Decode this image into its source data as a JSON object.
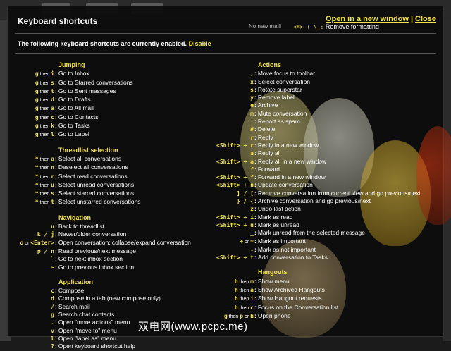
{
  "dialog": {
    "title": "Keyboard shortcuts",
    "open_new_window": "Open in a new window",
    "separator": "|",
    "close": "Close",
    "enabled_text": "The following keyboard shortcuts are currently enabled.",
    "disable": "Disable",
    "no_new_mail": "No new mail!",
    "remove_formatting_keys": "<⌘> + \\ :",
    "remove_formatting": "Remove formatting"
  },
  "jumping": {
    "title": "Jumping",
    "rows": [
      {
        "k": "g",
        "t": "i",
        "d": "Go to Inbox"
      },
      {
        "k": "g",
        "t": "s",
        "d": "Go to Starred conversations"
      },
      {
        "k": "g",
        "t": "t",
        "d": "Go to Sent messages"
      },
      {
        "k": "g",
        "t": "d",
        "d": "Go to Drafts"
      },
      {
        "k": "g",
        "t": "a",
        "d": "Go to All mail"
      },
      {
        "k": "g",
        "t": "c",
        "d": "Go to Contacts"
      },
      {
        "k": "g",
        "t": "k",
        "d": "Go to Tasks"
      },
      {
        "k": "g",
        "t": "l",
        "d": "Go to Label"
      }
    ]
  },
  "threadlist": {
    "title": "Threadlist selection",
    "rows": [
      {
        "k": "*",
        "t": "a",
        "d": "Select all conversations"
      },
      {
        "k": "*",
        "t": "n",
        "d": "Deselect all conversations"
      },
      {
        "k": "*",
        "t": "r",
        "d": "Select read conversations"
      },
      {
        "k": "*",
        "t": "u",
        "d": "Select unread conversations"
      },
      {
        "k": "*",
        "t": "s",
        "d": "Select starred conversations"
      },
      {
        "k": "*",
        "t": "t",
        "d": "Select unstarred conversations"
      }
    ]
  },
  "navigation": {
    "title": "Navigation",
    "rows": [
      {
        "keys": "u",
        "d": "Back to threadlist"
      },
      {
        "keys": "k / j",
        "d": "Newer/older conversation"
      },
      {
        "keys": "o or <Enter>",
        "d": "Open conversation; collapse/expand conversation"
      },
      {
        "keys": "p / n",
        "d": "Read previous/next message"
      },
      {
        "keys": "`",
        "d": "Go to next inbox section"
      },
      {
        "keys": "~",
        "d": "Go to previous inbox section"
      }
    ]
  },
  "application": {
    "title": "Application",
    "rows": [
      {
        "keys": "c",
        "d": "Compose"
      },
      {
        "keys": "d",
        "d": "Compose in a tab (new compose only)"
      },
      {
        "keys": "/",
        "d": "Search mail"
      },
      {
        "keys": "g",
        "d": "Search chat contacts"
      },
      {
        "keys": ".",
        "d": "Open \"more actions\" menu"
      },
      {
        "keys": "v",
        "d": "Open \"move to\" menu"
      },
      {
        "keys": "l",
        "d": "Open \"label as\" menu"
      },
      {
        "keys": "?",
        "d": "Open keyboard shortcut help"
      }
    ]
  },
  "actions": {
    "title": "Actions",
    "rows": [
      {
        "keys": ",",
        "d": "Move focus to toolbar"
      },
      {
        "keys": "x",
        "d": "Select conversation"
      },
      {
        "keys": "s",
        "d": "Rotate superstar"
      },
      {
        "keys": "y",
        "d": "Remove label"
      },
      {
        "keys": "e",
        "d": "Archive"
      },
      {
        "keys": "m",
        "d": "Mute conversation"
      },
      {
        "keys": "!",
        "d": "Report as spam"
      },
      {
        "keys": "#",
        "d": "Delete"
      },
      {
        "keys": "r",
        "d": "Reply"
      },
      {
        "keys": "<Shift> + r",
        "d": "Reply in a new window"
      },
      {
        "keys": "a",
        "d": "Reply all"
      },
      {
        "keys": "<Shift> + a",
        "d": "Reply all in a new window"
      },
      {
        "keys": "f",
        "d": "Forward"
      },
      {
        "keys": "<Shift> + f",
        "d": "Forward in a new window"
      },
      {
        "keys": "<Shift> + n",
        "d": "Update conversation"
      },
      {
        "keys": "] / [",
        "d": "Remove conversation from current view and go previous/next"
      },
      {
        "keys": "} / {",
        "d": "Archive conversation and go previous/next"
      },
      {
        "keys": "z",
        "d": "Undo last action"
      },
      {
        "keys": "<Shift> + i",
        "d": "Mark as read"
      },
      {
        "keys": "<Shift> + u",
        "d": "Mark as unread"
      },
      {
        "keys": "_",
        "d": "Mark unread from the selected message"
      },
      {
        "keys": "+ or =",
        "d": "Mark as important"
      },
      {
        "keys": "-",
        "d": "Mark as not important"
      },
      {
        "keys": "<Shift> + t",
        "d": "Add conversation to Tasks"
      }
    ]
  },
  "hangouts": {
    "title": "Hangouts",
    "rows": [
      {
        "k": "h",
        "t": "m",
        "d": "Show menu"
      },
      {
        "k": "h",
        "t": "a",
        "d": "Show Archived Hangouts"
      },
      {
        "k": "h",
        "t": "i",
        "d": "Show Hangout requests"
      },
      {
        "k": "h",
        "t": "c",
        "d": "Focus on the Conversation list"
      },
      {
        "k": "g then p or h",
        "t": "p",
        "d": "Open phone"
      }
    ]
  },
  "then_word": "then",
  "watermark": "双电网(www.pcpc.me)"
}
